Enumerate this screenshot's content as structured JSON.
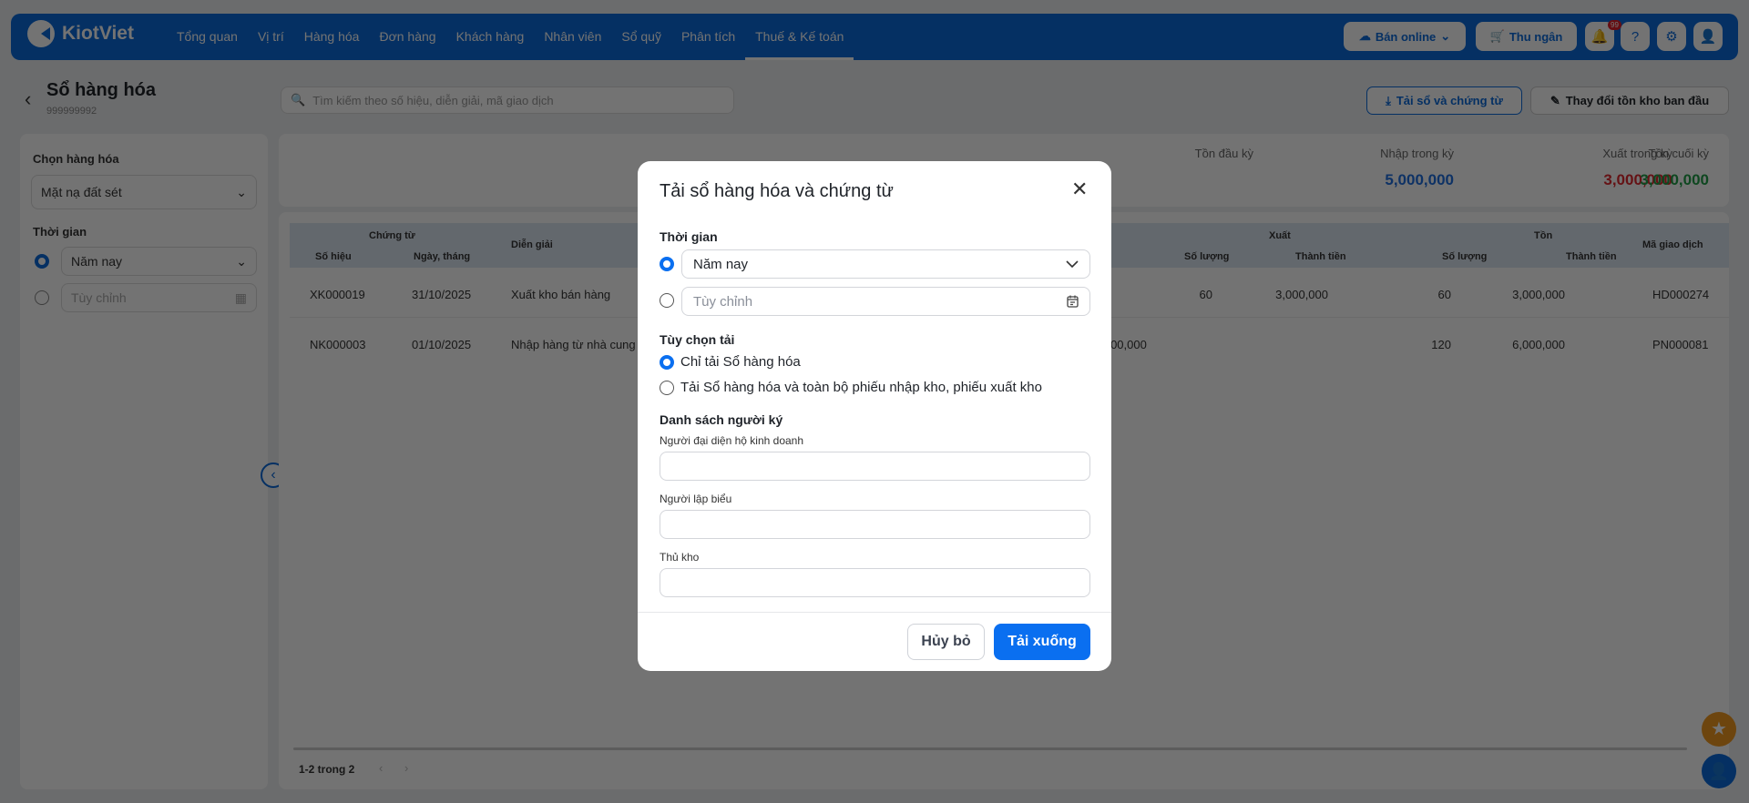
{
  "header": {
    "logo": "KiotViet",
    "nav": [
      "Tổng quan",
      "Vị trí",
      "Hàng hóa",
      "Đơn hàng",
      "Khách hàng",
      "Nhân viên",
      "Sổ quỹ",
      "Phân tích",
      "Thuế & Kế toán"
    ],
    "active_nav": "Thuế & Kế toán",
    "online_label": "Bán online",
    "cashier_label": "Thu ngân",
    "badge": "99"
  },
  "page": {
    "title": "Sổ hàng hóa",
    "subtitle": "999999992",
    "search_placeholder": "Tìm kiếm theo số hiệu, diễn giải, mã giao dịch",
    "download_btn": "Tải sổ và chứng từ",
    "change_btn": "Thay đổi tồn kho ban đầu"
  },
  "filters": {
    "product_label": "Chọn hàng hóa",
    "product_value": "Mặt nạ đất sét",
    "time_label": "Thời gian",
    "time_value": "Năm nay",
    "custom_placeholder": "Tùy chỉnh"
  },
  "summary": [
    {
      "label": "Tồn đầu kỳ",
      "value": "",
      "color": "#333333"
    },
    {
      "label": "Nhập trong kỳ",
      "value": "5,000,000",
      "color": "#1e6fe0"
    },
    {
      "label": "Xuất trong kỳ",
      "value": "3,000,000",
      "color": "#e0282e"
    },
    {
      "label": "Tồn cuối kỳ",
      "value": "3,000,000",
      "color": "#1e9e46"
    }
  ],
  "table": {
    "group_chungtu": "Chứng từ",
    "group_xuat": "Xuất",
    "group_ton": "Tồn",
    "h_sohieu": "Số hiệu",
    "h_ngay": "Ngày, tháng",
    "h_diengiai": "Diễn giải",
    "h_xuat_sl": "Số lượng",
    "h_xuat_tt": "Thành tiền",
    "h_ton_sl": "Số lượng",
    "h_ton_tt": "Thành tiền",
    "h_ma": "Mã giao dịch",
    "rows": [
      {
        "sohieu": "XK000019",
        "ngay": "31/10/2025",
        "diengiai": "Xuất kho bán hàng",
        "nhap_tt": "",
        "xuat_sl": "60",
        "xuat_tt": "3,000,000",
        "ton_sl": "60",
        "ton_tt": "3,000,000",
        "ma": "HD000274"
      },
      {
        "sohieu": "NK000003",
        "ngay": "01/10/2025",
        "diengiai": "Nhập hàng từ nhà cung cấp",
        "nhap_tt": "6,000,000",
        "xuat_sl": "",
        "xuat_tt": "",
        "ton_sl": "120",
        "ton_tt": "6,000,000",
        "ma": "PN000081"
      }
    ],
    "pagination": "1-2 trong 2"
  },
  "modal": {
    "title": "Tải sổ hàng hóa và chứng từ",
    "time_label": "Thời gian",
    "time_value": "Năm nay",
    "custom_placeholder": "Tùy chỉnh",
    "time_selected": "preset",
    "option_label": "Tùy chọn tải",
    "option1": "Chỉ tải Sổ hàng hóa",
    "option2": "Tải Sổ hàng hóa và toàn bộ phiếu nhập kho, phiếu xuất kho",
    "option_selected": 1,
    "signers_label": "Danh sách người ký",
    "signer1": "Người đại diện hộ kinh doanh",
    "signer2": "Người lập biểu",
    "signer3": "Thủ kho",
    "cancel": "Hủy bỏ",
    "download": "Tải xuống",
    "primary_color": "#0a6ff0"
  }
}
